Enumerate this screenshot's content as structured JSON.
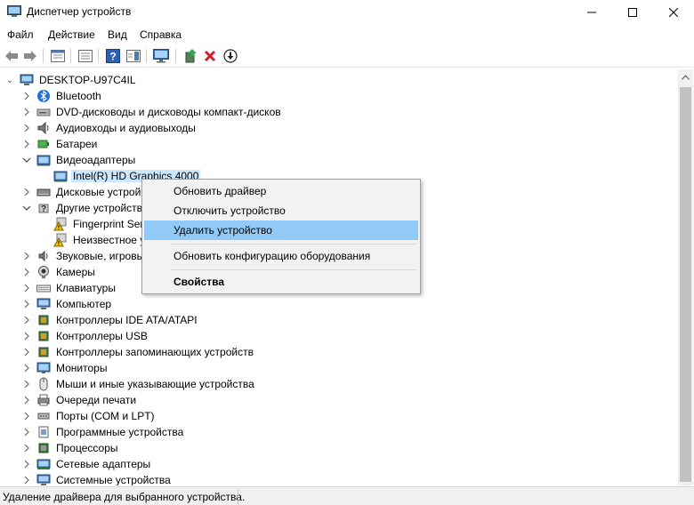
{
  "window": {
    "title": "Диспетчер устройств",
    "icon": "device-manager-icon"
  },
  "window_controls": {
    "minimize": "—",
    "maximize": "☐",
    "close": "✕"
  },
  "menu": [
    "Файл",
    "Действие",
    "Вид",
    "Справка"
  ],
  "toolbar": [
    "back-icon",
    "forward-icon",
    "properties-icon",
    "console-tree-icon",
    "help-icon",
    "action-pane-icon",
    "monitor-icon",
    "update-driver-icon",
    "uninstall-icon",
    "download-icon"
  ],
  "tree": {
    "root": "DESKTOP-U97C4IL",
    "rows": [
      {
        "label": "Bluetooth",
        "icon": "bluetooth-icon"
      },
      {
        "label": "DVD-дисководы и дисководы компакт-дисков",
        "icon": "dvd-drive-icon"
      },
      {
        "label": "Аудиовходы и аудиовыходы",
        "icon": "speaker-icon"
      },
      {
        "label": "Батареи",
        "icon": "battery-icon"
      },
      {
        "label": "Видеоадаптеры",
        "icon": "display-adapter-icon"
      },
      {
        "label": "Intel(R) HD Graphics 4000",
        "icon": "display-adapter-icon"
      },
      {
        "label": "Дисковые устрой",
        "icon": "disk-drive-icon"
      },
      {
        "label": "Другие устройств",
        "icon": "other-devices-icon"
      },
      {
        "label": "Fingerprint Ser",
        "icon": "warning-device-icon"
      },
      {
        "label": "Неизвестное у",
        "icon": "warning-device-icon"
      },
      {
        "label": "Звуковые, игровь",
        "icon": "sound-icon"
      },
      {
        "label": "Камеры",
        "icon": "camera-icon"
      },
      {
        "label": "Клавиатуры",
        "icon": "keyboard-icon"
      },
      {
        "label": "Компьютер",
        "icon": "computer-icon"
      },
      {
        "label": "Контроллеры IDE ATA/ATAPI",
        "icon": "ide-controller-icon"
      },
      {
        "label": "Контроллеры USB",
        "icon": "usb-icon"
      },
      {
        "label": "Контроллеры запоминающих устройств",
        "icon": "storage-controller-icon"
      },
      {
        "label": "Мониторы",
        "icon": "monitor-icon"
      },
      {
        "label": "Мыши и иные указывающие устройства",
        "icon": "mouse-icon"
      },
      {
        "label": "Очереди печати",
        "icon": "printer-icon"
      },
      {
        "label": "Порты (COM и LPT)",
        "icon": "port-icon"
      },
      {
        "label": "Программные устройства",
        "icon": "software-device-icon"
      },
      {
        "label": "Процессоры",
        "icon": "processor-icon"
      },
      {
        "label": "Сетевые адаптеры",
        "icon": "network-adapter-icon"
      },
      {
        "label": "Системные устройства",
        "icon": "system-device-icon"
      }
    ]
  },
  "context_menu": {
    "items": [
      "Обновить драйвер",
      "Отключить устройство",
      "Удалить устройство",
      "Обновить конфигурацию оборудования",
      "Свойства"
    ],
    "highlight_color": "#91c9f7"
  },
  "status": {
    "text": "Удаление драйвера для выбранного устройства."
  }
}
